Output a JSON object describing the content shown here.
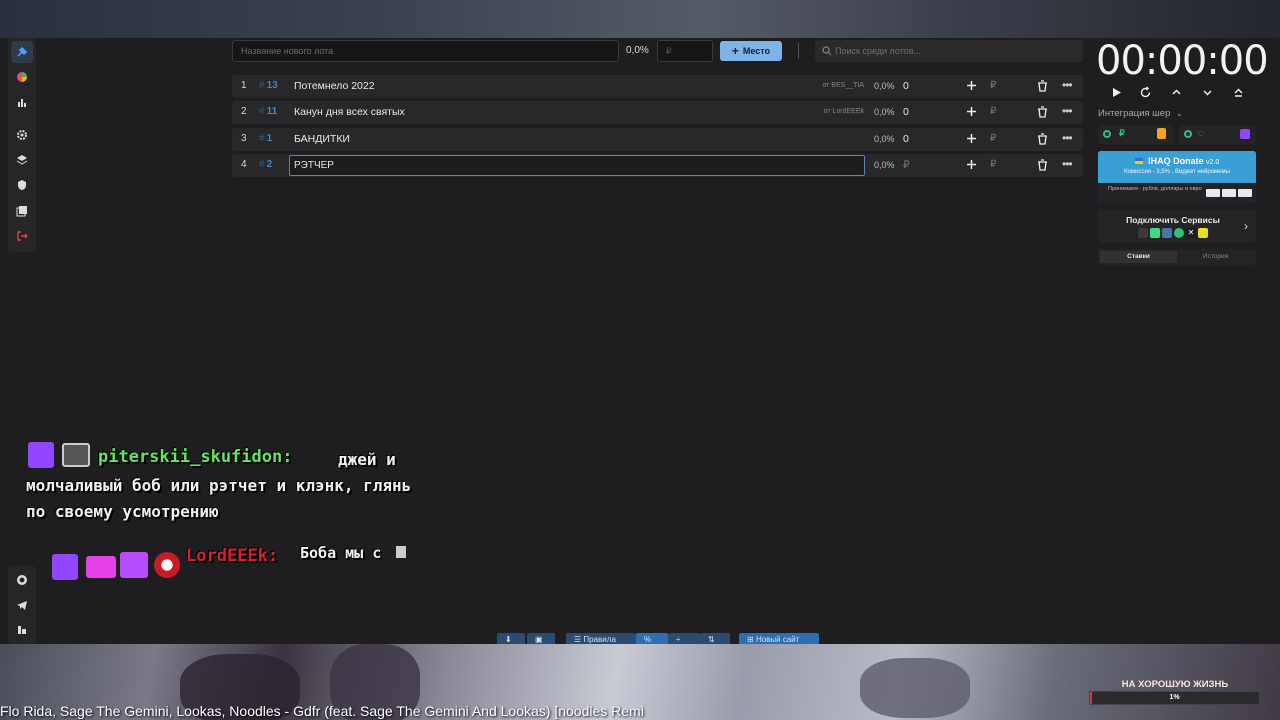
{
  "toolbar": {
    "new_lot_placeholder": "Название нового лота",
    "percent": "0,0%",
    "currency_placeholder": "₽",
    "place_button": "Место",
    "search_placeholder": "Поиск среди лотов..."
  },
  "lots": [
    {
      "index": "1",
      "id": "13",
      "name": "Потемнело 2022",
      "from": "от BES__TIA",
      "percent": "0,0%",
      "amount": "0",
      "currency": "₽"
    },
    {
      "index": "2",
      "id": "11",
      "name": "Канун дня всех святых",
      "from": "от LordEEEk",
      "percent": "0,0%",
      "amount": "0",
      "currency": "₽"
    },
    {
      "index": "3",
      "id": "1",
      "name": "БАНДИТКИ",
      "from": "",
      "percent": "0,0%",
      "amount": "0",
      "currency": "₽"
    },
    {
      "index": "4",
      "id": "2",
      "name": "РЭТЧЕР",
      "from": "",
      "percent": "0,0%",
      "amount": "",
      "currency": "₽"
    }
  ],
  "timer": {
    "value": "00:00:00"
  },
  "integration": {
    "title": "Интеграция шер"
  },
  "ihaq": {
    "title": "IHAQ Donate",
    "version": "v2.0",
    "subtitle": "Комиссия - 3,5% , Виджет нейромемы",
    "note": "Принимаем - рубли, доллары и евро"
  },
  "connect": {
    "label": "Подключить Сервисы"
  },
  "tabs": [
    "Ставки",
    "История"
  ],
  "chat": [
    {
      "user": "piterskii_skufidon:",
      "text": "джей и молчаливый боб или рэтчет и клэнк, глянь по своему усмотрению",
      "user_color": "#5fe85f"
    },
    {
      "user": "LordEEEk:",
      "text": "Боба мы с",
      "user_color": "#d8202c"
    }
  ],
  "bottom_bar": {
    "rules": "Правила",
    "new_site": "Новый сайт",
    "percent_btn": "%"
  },
  "now_playing": "Flo Rida, Sage The Gemini, Lookas, Noodles - Gdfr (feat. Sage The Gemini And Lookas) [noodles Remi",
  "goal": {
    "title": "НА ХОРОШУЮ ЖИЗНЬ",
    "percent_label": "1%",
    "progress": 0.01
  },
  "colors": {
    "accent": "#7eb2e8",
    "id_blue": "#3f86c6",
    "twitch": "#9146ff",
    "goal_red": "#d23a4c"
  }
}
